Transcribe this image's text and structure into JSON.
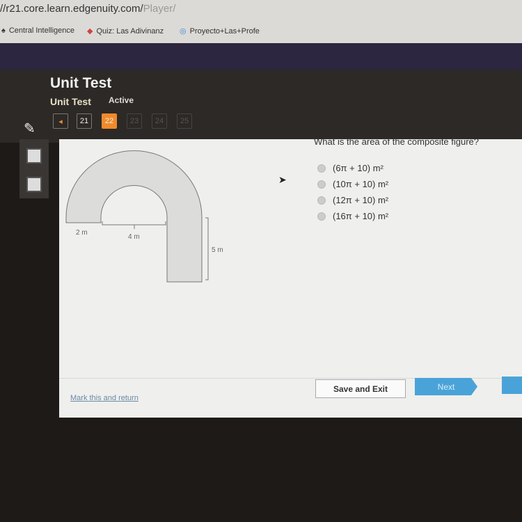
{
  "browser": {
    "url_main": "//r21.core.learn.edgenuity.com/",
    "url_path": "Player/",
    "bookmarks": [
      "Central Intelligence",
      "Quiz: Las Adivinanz",
      "Proyecto+Las+Profe"
    ]
  },
  "header": {
    "title": "Unit Test",
    "subtitle": "Unit Test",
    "status": "Active"
  },
  "nav": {
    "items": [
      "21",
      "22",
      "23",
      "24",
      "25"
    ],
    "current": "22"
  },
  "question": {
    "text": "What is the area of the composite figure?",
    "options": [
      "(6π + 10) m²",
      "(10π + 10) m²",
      "(12π + 10) m²",
      "(16π + 10) m²"
    ]
  },
  "figure": {
    "labels": {
      "left": "2 m",
      "inner": "4 m",
      "height": "5 m"
    }
  },
  "footer": {
    "mark": "Mark this and return",
    "save": "Save and Exit",
    "next": "Next"
  },
  "colors": {
    "accent": "#f08a2c",
    "next": "#4aa3d8"
  }
}
